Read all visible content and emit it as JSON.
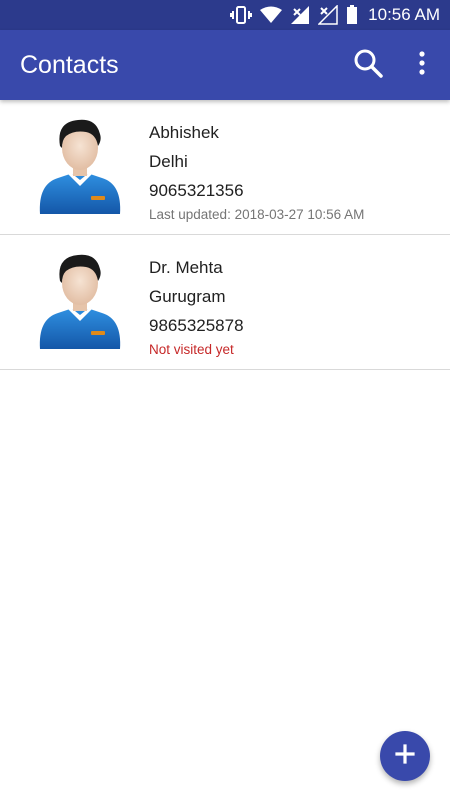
{
  "status_bar": {
    "time": "10:56 AM",
    "icons": [
      "vibrate-icon",
      "wifi-icon",
      "signal-icon",
      "signal-no-service-icon",
      "battery-icon"
    ]
  },
  "app_bar": {
    "title": "Contacts",
    "actions": [
      "search-icon",
      "more-vert-icon"
    ]
  },
  "contacts": [
    {
      "name": "Abhishek",
      "city": "Delhi",
      "phone": "9065321356",
      "status": "Last updated: 2018-03-27 10:56 AM",
      "status_color": "#757575"
    },
    {
      "name": "Dr. Mehta",
      "city": "Gurugram",
      "phone": "9865325878",
      "status": "Not visited yet",
      "status_color": "#c62828"
    }
  ],
  "fab": {
    "icon": "add-icon"
  },
  "colors": {
    "status_bar": "#2c3a8c",
    "app_bar": "#3949ab",
    "fab": "#3949ab",
    "divider": "#d9d9d9"
  }
}
